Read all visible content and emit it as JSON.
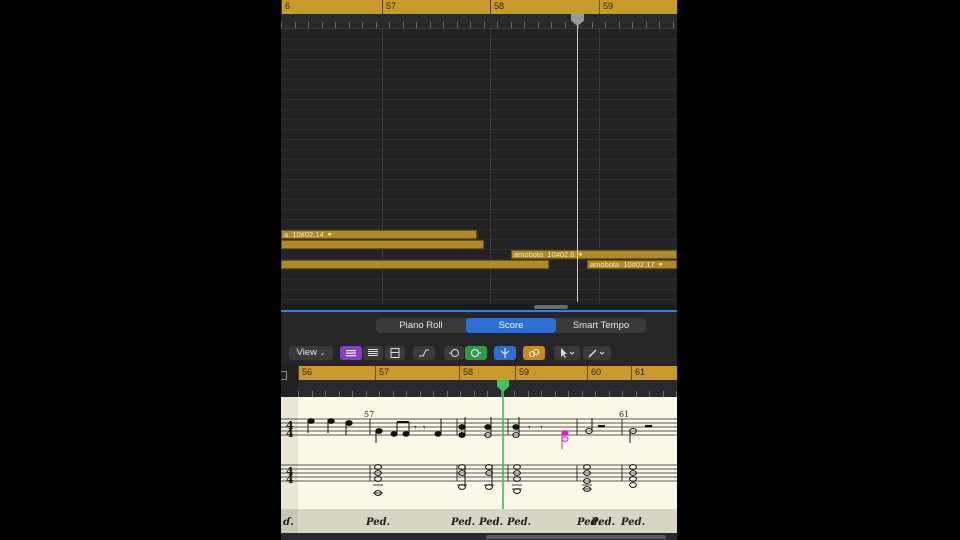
{
  "tracks": {
    "ruler_bars": [
      "6",
      "57",
      "58",
      "59"
    ],
    "regions": [
      {
        "label": "a_10#02.14",
        "loop_icon": "loop-icon"
      },
      {
        "label": "",
        "loop_icon": ""
      },
      {
        "label": "amobota_10#02.‍6",
        "loop_icon": "loop-icon"
      },
      {
        "label": "",
        "loop_icon": ""
      },
      {
        "label": "amobota_10#02.17",
        "loop_icon": "loop-icon"
      }
    ]
  },
  "editor": {
    "tabs": [
      "Piano Roll",
      "Score",
      "Smart Tempo"
    ],
    "active_tab": "Score",
    "view_label": "View"
  },
  "score": {
    "ruler_bars": [
      "56",
      "57",
      "58",
      "59",
      "60",
      "61"
    ],
    "measure_numbers": [
      "57",
      "61"
    ],
    "time_signature_top": "4",
    "time_signature_bottom": "4",
    "pedal_marks": [
      "ɗ.",
      "Ped.",
      "Ped.",
      "Ped.",
      "Ped.",
      "Ped.",
      "Ped.",
      "Ped."
    ]
  },
  "colors": {
    "region": "#b08a25",
    "accent_blue": "#2f6fd4",
    "playhead_green": "#41c35a",
    "selected_note": "#e020c0"
  }
}
